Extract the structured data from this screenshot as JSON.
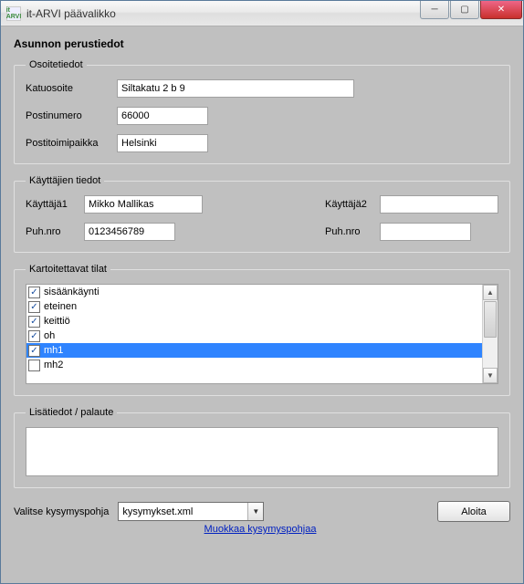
{
  "window": {
    "title": "it-ARVI päävalikko",
    "app_icon_text": "it\nARVI"
  },
  "heading": "Asunnon perustiedot",
  "groups": {
    "address": {
      "legend": "Osoitetiedot",
      "street_label": "Katuosoite",
      "street_value": "Siltakatu 2 b 9",
      "postal_label": "Postinumero",
      "postal_value": "66000",
      "city_label": "Postitoimipaikka",
      "city_value": "Helsinki"
    },
    "users": {
      "legend": "Käyttäjien tiedot",
      "user1_label": "Käyttäjä1",
      "user1_value": "Mikko Mallikas",
      "user1_phone_label": "Puh.nro",
      "user1_phone_value": "0123456789",
      "user2_label": "Käyttäjä2",
      "user2_value": "",
      "user2_phone_label": "Puh.nro",
      "user2_phone_value": ""
    },
    "rooms": {
      "legend": "Kartoitettavat tilat",
      "items": [
        {
          "label": "sisäänkäynti",
          "checked": true,
          "selected": false
        },
        {
          "label": "eteinen",
          "checked": true,
          "selected": false
        },
        {
          "label": "keittiö",
          "checked": true,
          "selected": false
        },
        {
          "label": "oh",
          "checked": true,
          "selected": false
        },
        {
          "label": "mh1",
          "checked": true,
          "selected": true
        },
        {
          "label": "mh2",
          "checked": false,
          "selected": false
        }
      ]
    },
    "feedback": {
      "legend": "Lisätiedot / palaute",
      "value": ""
    }
  },
  "bottom": {
    "template_label": "Valitse kysymyspohja",
    "template_selected": "kysymykset.xml",
    "edit_template_link": "Muokkaa kysymyspohjaa",
    "start_button": "Aloita"
  }
}
